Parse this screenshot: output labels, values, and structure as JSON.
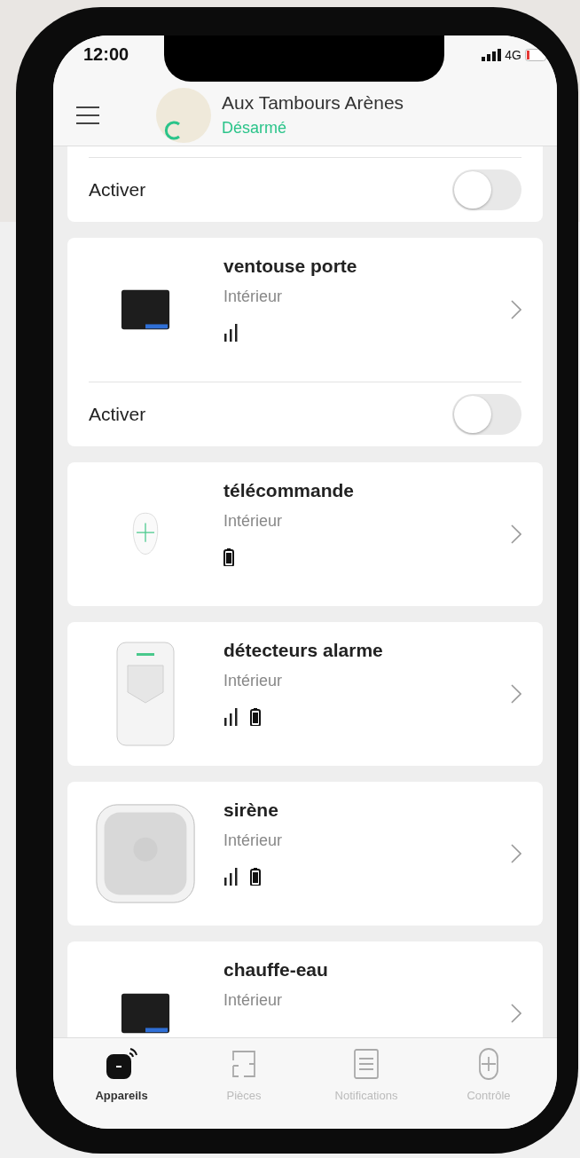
{
  "status_bar": {
    "time": "12:00",
    "network": "4G"
  },
  "header": {
    "title": "Aux Tambours Arènes",
    "status": "Désarmé"
  },
  "partial_card": {
    "toggle": {
      "label": "Activer",
      "on": false
    }
  },
  "devices": [
    {
      "kind": "relay",
      "name": "ventouse porte",
      "room": "Intérieur",
      "indicators": [
        {
          "kind": "signal"
        }
      ],
      "toggle": {
        "label": "Activer",
        "on": false
      }
    },
    {
      "kind": "remote",
      "name": "télécommande",
      "room": "Intérieur",
      "indicators": [
        {
          "kind": "battery"
        }
      ]
    },
    {
      "kind": "motion",
      "name": "détecteurs alarme",
      "room": "Intérieur",
      "indicators": [
        {
          "kind": "signal"
        },
        {
          "kind": "battery"
        }
      ]
    },
    {
      "kind": "siren",
      "name": "sirène",
      "room": "Intérieur",
      "indicators": [
        {
          "kind": "signal"
        },
        {
          "kind": "battery"
        }
      ]
    },
    {
      "kind": "relay",
      "name": "chauffe-eau",
      "room": "Intérieur"
    }
  ],
  "tabs": [
    {
      "kind": "devices",
      "label": "Appareils",
      "selected": true
    },
    {
      "kind": "rooms",
      "label": "Pièces",
      "selected": false
    },
    {
      "kind": "notifications",
      "label": "Notifications",
      "selected": false
    },
    {
      "kind": "control",
      "label": "Contrôle",
      "selected": false
    }
  ]
}
